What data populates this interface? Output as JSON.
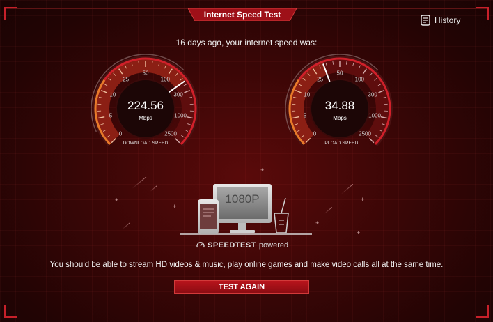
{
  "header": {
    "title": "Internet Speed Test",
    "history_label": "History"
  },
  "summary": {
    "subtitle": "16 days ago, your internet speed was:"
  },
  "gauges": [
    {
      "id": "download",
      "value": "224.56",
      "unit": "Mbps",
      "label": "DOWNLOAD SPEED",
      "reading_mbps": 224.56,
      "ticks": [
        "0",
        "5",
        "10",
        "25",
        "50",
        "100",
        "300",
        "1000",
        "2500"
      ]
    },
    {
      "id": "upload",
      "value": "34.88",
      "unit": "Mbps",
      "label": "UPLOAD SPEED",
      "reading_mbps": 34.88,
      "ticks": [
        "0",
        "5",
        "10",
        "25",
        "50",
        "100",
        "300",
        "1000",
        "2500"
      ]
    }
  ],
  "illustration": {
    "monitor_text": "1080P"
  },
  "branding": {
    "brand": "SPEEDTEST",
    "powered": "powered"
  },
  "message": "You should be able to stream HD videos & music, play online games and make video calls all at the same time.",
  "actions": {
    "test_again": "TEST AGAIN"
  },
  "colors": {
    "accent": "#c8202a",
    "background": "#3a0606",
    "gauge_active": "#e8502a",
    "text": "#ffffff"
  }
}
